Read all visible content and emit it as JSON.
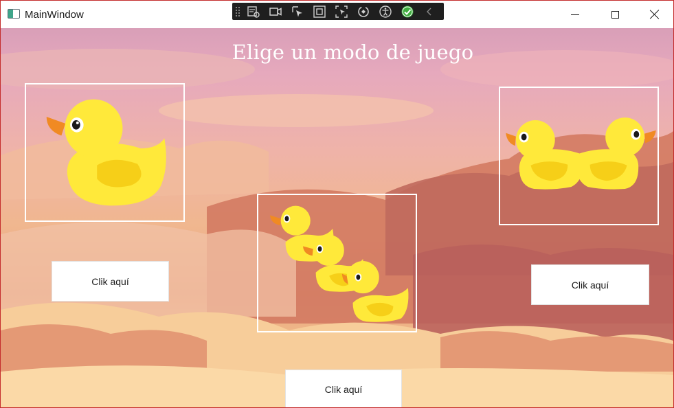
{
  "window": {
    "title": "MainWindow",
    "frame_color": "#c42b2b"
  },
  "title_controls": [
    {
      "name": "minimize",
      "icon": "minimize-icon"
    },
    {
      "name": "maximize",
      "icon": "maximize-icon"
    },
    {
      "name": "close",
      "icon": "close-icon"
    }
  ],
  "debug_toolbar": {
    "tools": [
      "select-element-icon",
      "video-capture-icon",
      "pointer-select-icon",
      "display-layout-icon",
      "track-focus-icon",
      "hot-reload-icon",
      "accessibility-icon",
      "check-icon",
      "collapse-icon"
    ]
  },
  "main": {
    "heading": "Elige un modo de juego",
    "modes": [
      {
        "image": "single-duck",
        "button_label": "Clik aquí"
      },
      {
        "image": "three-ducks",
        "button_label": "Clik aquí"
      },
      {
        "image": "two-ducks",
        "button_label": "Clik aquí"
      }
    ]
  },
  "colors": {
    "duck_body": "#ffe93a",
    "duck_wing": "#f6cf18",
    "duck_beak": "#f08a23",
    "sky_top": "#d99fb8",
    "sky_bottom": "#fbd7a2"
  }
}
